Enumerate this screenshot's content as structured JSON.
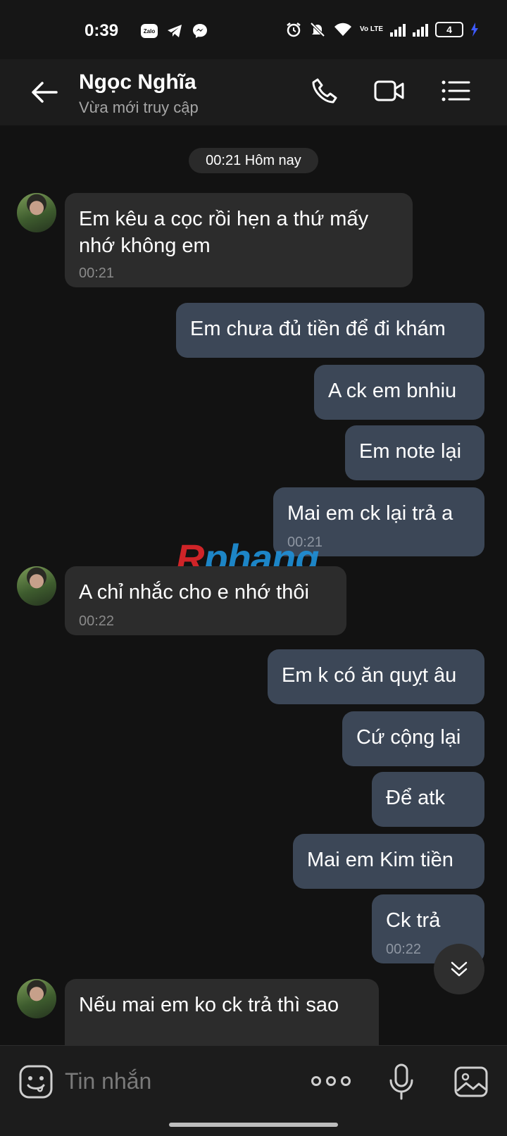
{
  "status_bar": {
    "time": "0:39",
    "app_icons": [
      "zalo-icon",
      "telegram-icon",
      "messenger-icon"
    ],
    "zalo_label": "Zalo",
    "volte": "Vo LTE",
    "battery": "4"
  },
  "header": {
    "name": "Ngọc Nghĩa",
    "status": "Vừa mới truy cập"
  },
  "chat": {
    "date": "00:21 Hôm nay",
    "messages": [
      {
        "dir": "in",
        "text": "Em kêu a cọc rồi hẹn a thứ mấy nhớ không em",
        "time": "00:21",
        "avatar": true
      },
      {
        "dir": "out",
        "text": "Em chưa đủ tiền để đi khám"
      },
      {
        "dir": "out",
        "text": "A ck em bnhiu"
      },
      {
        "dir": "out",
        "text": "Em note lại"
      },
      {
        "dir": "out",
        "text": "Mai em ck lại trả a",
        "time": "00:21"
      },
      {
        "dir": "in",
        "text": "A chỉ nhắc cho e nhớ thôi",
        "time": "00:22",
        "avatar": true
      },
      {
        "dir": "out",
        "text": "Em k có ăn quỵt âu"
      },
      {
        "dir": "out",
        "text": "Cứ cộng lại"
      },
      {
        "dir": "out",
        "text": "Để atk"
      },
      {
        "dir": "out",
        "text": "Mai em Kim tiền"
      },
      {
        "dir": "out",
        "text": "Ck trả",
        "time": "00:22"
      },
      {
        "dir": "in",
        "text": "Nếu mai em ko ck trả thì sao",
        "avatar": true
      }
    ]
  },
  "watermark": {
    "r": "R",
    "rest": "phang"
  },
  "input": {
    "placeholder": "Tin nhắn"
  },
  "colors": {
    "background": "#121212",
    "incoming": "#2c2c2c",
    "outgoing": "#3c4757",
    "accent_watermark_red": "#e0262a",
    "accent_watermark_blue": "#1f8fd6"
  }
}
